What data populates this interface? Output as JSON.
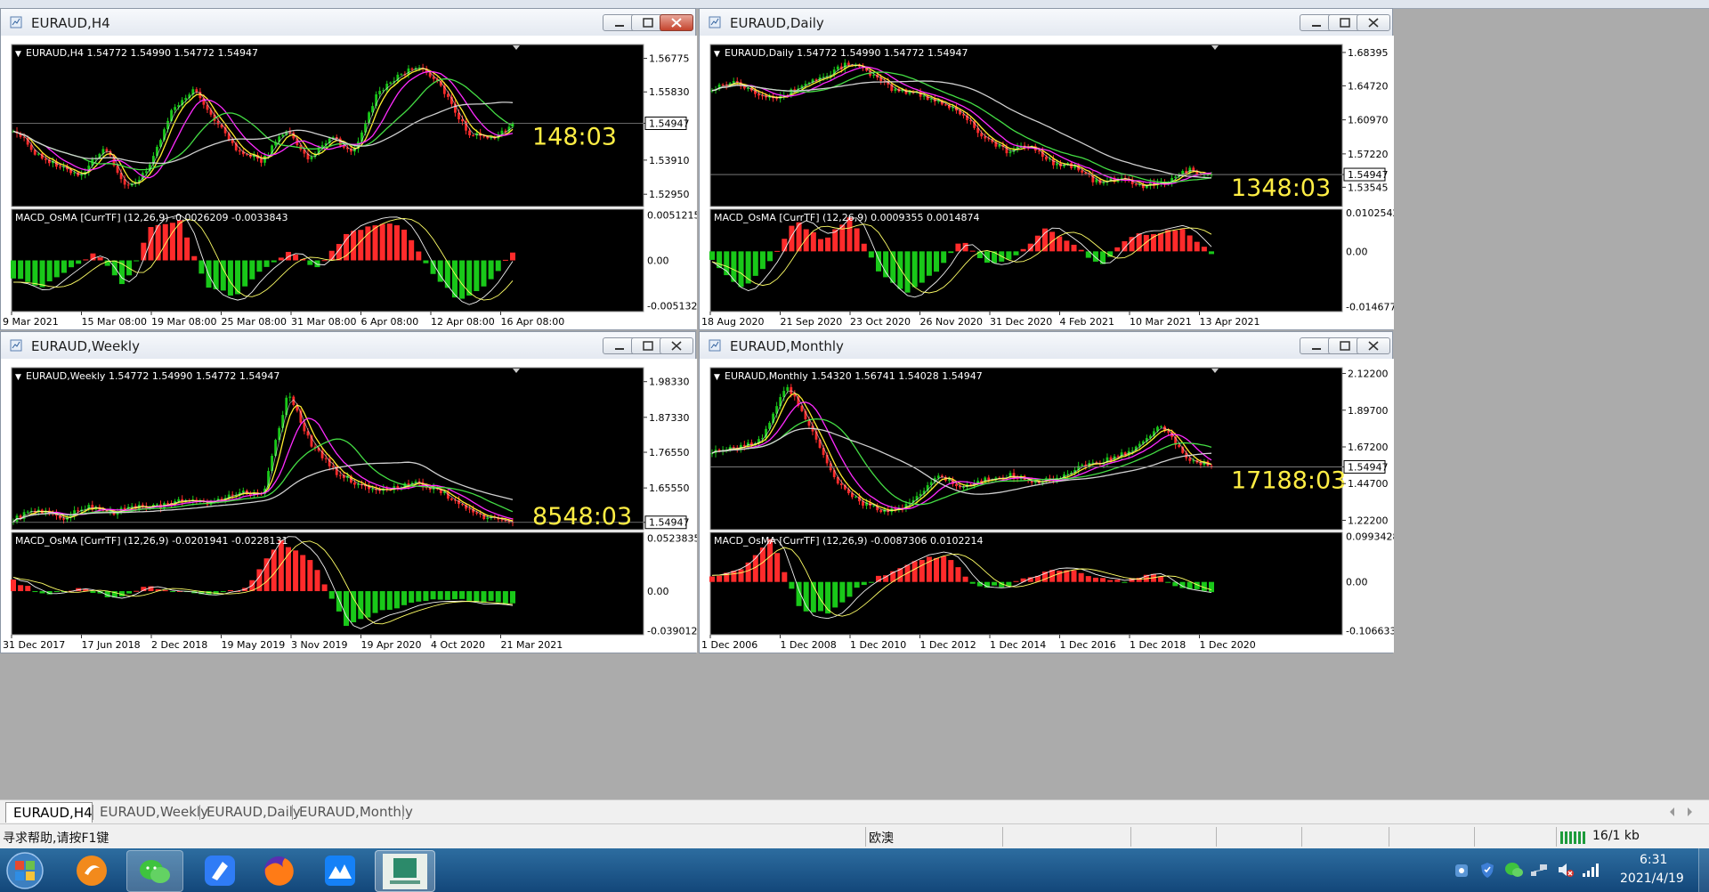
{
  "colors": {
    "bull": "#19c819",
    "bear": "#ff2b2b",
    "ma_yellow": "#ffee30",
    "ma_magenta": "#ff2bff",
    "ma_green": "#44dd44",
    "ma_gray": "#d0d0d0",
    "macd_main": "#f0f0f0",
    "macd_signal": "#ffff66",
    "timer": "#ffee44"
  },
  "windows": [
    {
      "id": "h4",
      "title": "EURAUD,H4",
      "close_active": true,
      "price_info": "EURAUD,H4  1.54772 1.54990 1.54772 1.54947",
      "price_ticks": [
        "1.56775",
        "1.55830",
        "1.54947",
        "1.53910",
        "1.52950"
      ],
      "price_tick_vals": [
        1.56775,
        1.5583,
        1.54947,
        1.5391,
        1.5295
      ],
      "price_range": [
        1.52604,
        1.57164
      ],
      "current_price": "1.54947",
      "current_val": 1.54947,
      "timer": "148:03",
      "macd_info": "MACD_OsMA [CurrTF] (12,26,9) -0.0026209 -0.0033843",
      "macd_ticks": [
        "0.0051215",
        "0.00",
        "-0.0051325"
      ],
      "macd_tick_vals": [
        0.0051215,
        0,
        -0.0051325
      ],
      "macd_range": [
        -0.0058,
        0.0058
      ],
      "x_labels": [
        "9 Mar 2021",
        "15 Mar 08:00",
        "19 Mar 08:00",
        "25 Mar 08:00",
        "31 Mar 08:00",
        "6 Apr 08:00",
        "12 Apr 08:00",
        "16 Apr 08:00"
      ],
      "chart_data": {
        "type": "candlestick",
        "title": "EURAUD,H4",
        "y_ticks": [
          "1.56775",
          "1.55830",
          "1.54947",
          "1.53910",
          "1.52950"
        ],
        "price_path": [
          1.548,
          1.541,
          1.537,
          1.535,
          1.543,
          1.531,
          1.537,
          1.553,
          1.559,
          1.549,
          1.541,
          1.539,
          1.548,
          1.539,
          1.546,
          1.541,
          1.558,
          1.563,
          1.566,
          1.558,
          1.547,
          1.545,
          1.549
        ],
        "last": 1.54947,
        "macd_path": [
          -0.002,
          -0.003,
          -0.001,
          0.001,
          -0.003,
          0.004,
          0.0045,
          -0.003,
          -0.004,
          -0.001,
          0.001,
          -0.001,
          0.003,
          0.004,
          0.004,
          -0.001,
          -0.0045,
          -0.003,
          0.001
        ]
      }
    },
    {
      "id": "daily",
      "title": "EURAUD,Daily",
      "close_active": false,
      "price_info": "EURAUD,Daily  1.54772 1.54990 1.54772 1.54947",
      "price_ticks": [
        "1.68395",
        "1.64720",
        "1.60970",
        "1.57220",
        "1.54947",
        "1.53545"
      ],
      "price_tick_vals": [
        1.68395,
        1.6472,
        1.6097,
        1.5722,
        1.54947,
        1.53545
      ],
      "price_range": [
        1.5142,
        1.6927
      ],
      "current_price": "1.54947",
      "current_val": 1.54947,
      "timer": "1348:03",
      "macd_info": "MACD_OsMA [CurrTF] (12,26,9) 0.0009355 0.0014874",
      "macd_ticks": [
        "0.0102542",
        "0.00",
        "-0.0146778"
      ],
      "macd_tick_vals": [
        0.0102542,
        0,
        -0.0146778
      ],
      "macd_range": [
        -0.016,
        0.0112
      ],
      "x_labels": [
        "18 Aug 2020",
        "21 Sep 2020",
        "23 Oct 2020",
        "26 Nov 2020",
        "31 Dec 2020",
        "4 Feb 2021",
        "10 Mar 2021",
        "13 Apr 2021"
      ],
      "chart_data": {
        "type": "candlestick",
        "title": "EURAUD,Daily",
        "y_ticks": [
          "1.68395",
          "1.64720",
          "1.60970",
          "1.57220",
          "1.53545"
        ],
        "price_path": [
          1.645,
          1.652,
          1.64,
          1.633,
          1.649,
          1.658,
          1.673,
          1.66,
          1.642,
          1.639,
          1.63,
          1.617,
          1.59,
          1.575,
          1.581,
          1.563,
          1.558,
          1.54,
          1.545,
          1.537,
          1.54,
          1.555,
          1.548
        ],
        "last": 1.54947,
        "macd_path": [
          -0.002,
          -0.01,
          -0.004,
          0.008,
          0.003,
          0.009,
          -0.005,
          -0.011,
          -0.006,
          0.003,
          -0.004,
          -0.001,
          0.006,
          0.002,
          -0.004,
          0.004,
          0.005,
          0.006,
          -0.001
        ]
      }
    },
    {
      "id": "weekly",
      "title": "EURAUD,Weekly",
      "close_active": false,
      "price_info": "EURAUD,Weekly  1.54772 1.54990 1.54772 1.54947",
      "price_ticks": [
        "1.98330",
        "1.87330",
        "1.76550",
        "1.65550",
        "1.54947"
      ],
      "price_tick_vals": [
        1.9833,
        1.8733,
        1.7655,
        1.6555,
        1.54947
      ],
      "price_range": [
        1.5268,
        2.0264
      ],
      "current_price": "1.54947",
      "current_val": 1.54947,
      "timer": "8548:03",
      "macd_info": "MACD_OsMA [CurrTF] (12,26,9) -0.0201941 -0.0228131",
      "macd_ticks": [
        "0.0523835",
        "0.00",
        "-0.0390127"
      ],
      "macd_tick_vals": [
        0.0523835,
        0,
        -0.0390127
      ],
      "macd_range": [
        -0.043,
        0.058
      ],
      "x_labels": [
        "31 Dec 2017",
        "17 Jun 2018",
        "2 Dec 2018",
        "19 May 2019",
        "3 Nov 2019",
        "19 Apr 2020",
        "4 Oct 2020",
        "21 Mar 2021"
      ],
      "chart_data": {
        "type": "candlestick",
        "title": "EURAUD,Weekly",
        "y_ticks": [
          "1.98330",
          "1.87330",
          "1.76550",
          "1.65550",
          "1.54947"
        ],
        "price_path": [
          1.56,
          1.59,
          1.56,
          1.6,
          1.58,
          1.6,
          1.6,
          1.62,
          1.61,
          1.64,
          1.64,
          1.95,
          1.78,
          1.7,
          1.66,
          1.65,
          1.67,
          1.65,
          1.6,
          1.56,
          1.549
        ],
        "last": 1.54947,
        "macd_path": [
          0.01,
          -0.004,
          0.003,
          -0.007,
          0.004,
          0.0,
          -0.003,
          0.002,
          0.05,
          0.03,
          -0.035,
          -0.02,
          -0.012,
          -0.008,
          -0.01,
          -0.012
        ]
      }
    },
    {
      "id": "monthly",
      "title": "EURAUD,Monthly",
      "close_active": false,
      "price_info": "EURAUD,Monthly  1.54320 1.56741 1.54028 1.54947",
      "price_ticks": [
        "2.12200",
        "1.89700",
        "1.67200",
        "1.54947",
        "1.44700",
        "1.22200"
      ],
      "price_tick_vals": [
        2.122,
        1.897,
        1.672,
        1.54947,
        1.447,
        1.222
      ],
      "price_range": [
        1.1645,
        2.1576
      ],
      "current_price": "1.54947",
      "current_val": 1.54947,
      "timer": "17188:03",
      "macd_info": "MACD_OsMA [CurrTF] (12,26,9) -0.0087306 0.0102214",
      "macd_ticks": [
        "0.0993428",
        "0.00",
        "-0.1066335"
      ],
      "macd_tick_vals": [
        0.0993428,
        0,
        -0.1066335
      ],
      "macd_range": [
        -0.115,
        0.108
      ],
      "x_labels": [
        "1 Dec 2006",
        "1 Dec 2008",
        "1 Dec 2010",
        "1 Dec 2012",
        "1 Dec 2014",
        "1 Dec 2016",
        "1 Dec 2018",
        "1 Dec 2020"
      ],
      "chart_data": {
        "type": "candlestick",
        "title": "EURAUD,Monthly",
        "y_ticks": [
          "2.12200",
          "1.89700",
          "1.67200",
          "1.44700",
          "1.22200"
        ],
        "price_path": [
          1.65,
          1.66,
          1.72,
          2.05,
          1.78,
          1.45,
          1.33,
          1.27,
          1.32,
          1.5,
          1.42,
          1.47,
          1.5,
          1.46,
          1.49,
          1.56,
          1.6,
          1.66,
          1.8,
          1.61,
          1.549
        ],
        "last": 1.54947,
        "macd_path": [
          0.01,
          0.03,
          0.095,
          -0.06,
          -0.07,
          -0.01,
          0.02,
          0.05,
          0.055,
          -0.01,
          -0.01,
          0.015,
          0.03,
          0.01,
          0.0,
          0.02,
          -0.015,
          -0.02
        ]
      }
    }
  ],
  "tabs": [
    "EURAUD,H4",
    "EURAUD,Weekly",
    "EURAUD,Daily",
    "EURAUD,Monthly"
  ],
  "status": {
    "help": "寻求帮助,请按F1键",
    "symbol": "欧澳",
    "traffic": "16/1 kb"
  },
  "taskbar": {
    "apps": [
      "start-orb",
      "media-player-icon",
      "wechat-icon",
      "feishu-icon",
      "firefox-icon",
      "lark-docs-icon",
      "metatrader-icon"
    ],
    "time": "6:31",
    "date": "2021/4/19"
  }
}
